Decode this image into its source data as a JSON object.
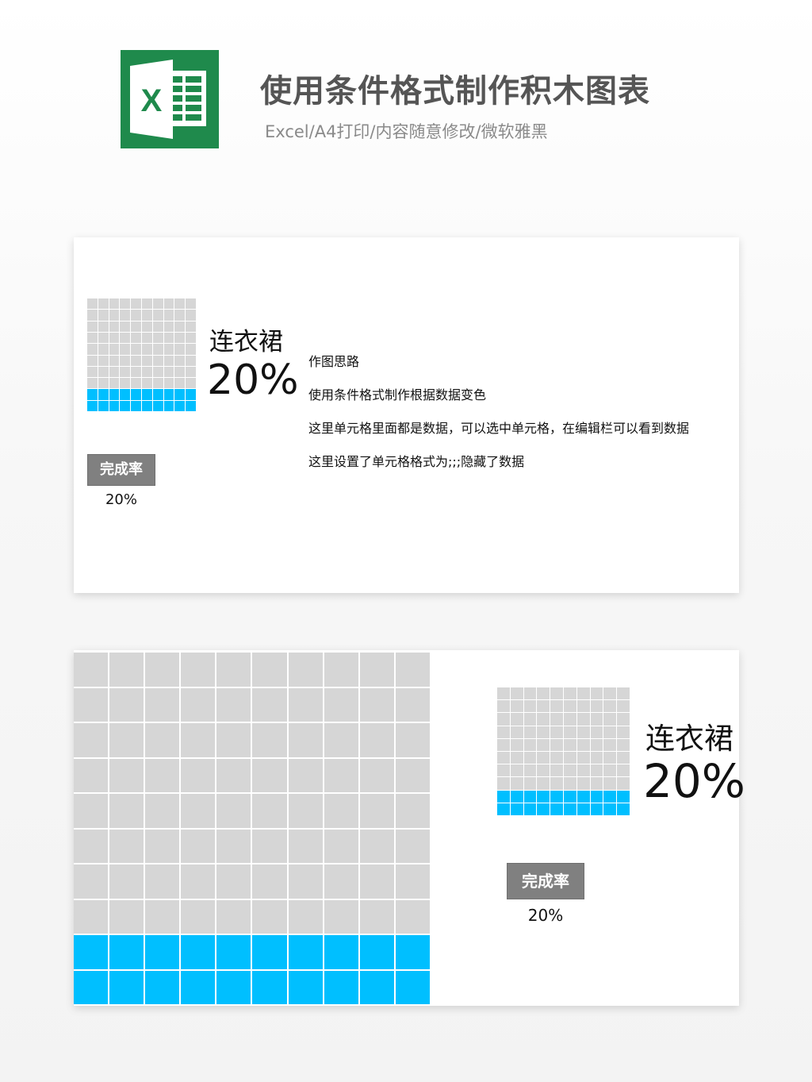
{
  "header": {
    "title": "使用条件格式制作积木图表",
    "subtitle": "Excel/A4打印/内容随意修改/微软雅黑",
    "logo_letter": "X"
  },
  "card1": {
    "item_name": "连衣裙",
    "percent": "20%",
    "badge_label": "完成率",
    "badge_value": "20%",
    "notes": [
      "作图思路",
      "使用条件格式制作根据数据变色",
      "这里单元格里面都是数据，可以选中单元格，在编辑栏可以看到数据",
      "这里设置了单元格格式为;;;隐藏了数据"
    ]
  },
  "card2": {
    "item_name": "连衣裙",
    "percent": "20%",
    "badge_label": "完成率",
    "badge_value": "20%"
  },
  "waffle": {
    "value": 0.2,
    "rows": 10,
    "cols": 10,
    "filled_color": "#00bfff",
    "empty_color": "#d6d6d6"
  },
  "colors": {
    "excel_green": "#1f8a4c",
    "badge_gray": "#808080"
  }
}
